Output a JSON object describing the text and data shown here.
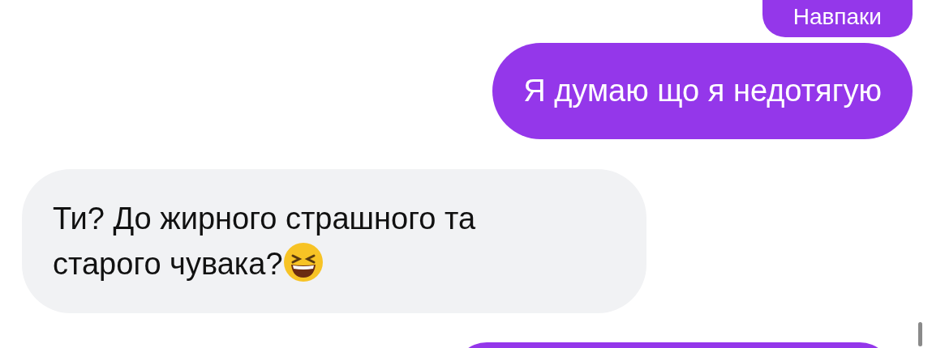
{
  "messages": [
    {
      "kind": "outgoing",
      "text": "Навпаки",
      "has_emoji": false
    },
    {
      "kind": "outgoing",
      "text": "Я думаю що я недотягую",
      "has_emoji": false
    },
    {
      "kind": "incoming",
      "text": "Ти? До жирного страшного та старого чувака?",
      "has_emoji": true
    },
    {
      "kind": "outgoing",
      "has_emoji": false
    }
  ]
}
